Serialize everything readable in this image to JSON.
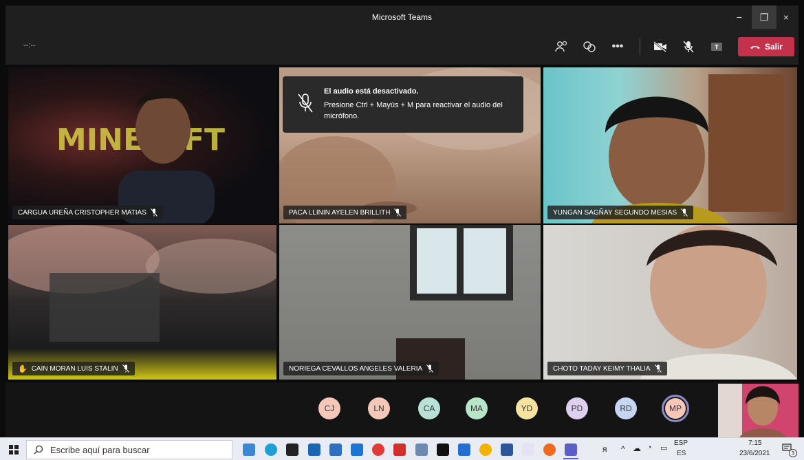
{
  "window": {
    "title": "Microsoft Teams",
    "minimize": "−",
    "restore": "❐",
    "close": "×"
  },
  "toolbar": {
    "timer": "--:--",
    "leave_label": "Salir"
  },
  "notice": {
    "title": "El audio está desactivado.",
    "body": "Presione Ctrl + Mayús + M para reactivar el audio del micrófono."
  },
  "participants": [
    {
      "name": "CARGUA UREÑA CRISTOPHER MATIAS",
      "hand_raised": false
    },
    {
      "name": "PACA LLININ AYELEN BRILLITH",
      "hand_raised": false
    },
    {
      "name": "YUNGAN SAGÑAY SEGUNDO MESIAS",
      "hand_raised": false
    },
    {
      "name": "CAIN MORAN LUIS STALIN",
      "hand_raised": true
    },
    {
      "name": "NORIEGA CEVALLOS ANGELES VALERIA",
      "hand_raised": false
    },
    {
      "name": "CHOTO TADAY KEIMY THALIA",
      "hand_raised": false
    }
  ],
  "avatars": [
    {
      "initials": "CJ",
      "color": "#f4c7b8"
    },
    {
      "initials": "LN",
      "color": "#f4c7b8"
    },
    {
      "initials": "CA",
      "color": "#b9e0d7"
    },
    {
      "initials": "MA",
      "color": "#b6e5c8"
    },
    {
      "initials": "YD",
      "color": "#f7e3a0"
    },
    {
      "initials": "PD",
      "color": "#ddd0ef"
    },
    {
      "initials": "RD",
      "color": "#c6d6f2"
    },
    {
      "initials": "MP",
      "color": "#f4c7b8"
    }
  ],
  "taskbar": {
    "search_placeholder": "Escribe aquí para buscar",
    "lang_top": "ESP",
    "lang_bottom": "ES",
    "time": "7:15",
    "date": "23/6/2021",
    "notif_count": "3"
  }
}
